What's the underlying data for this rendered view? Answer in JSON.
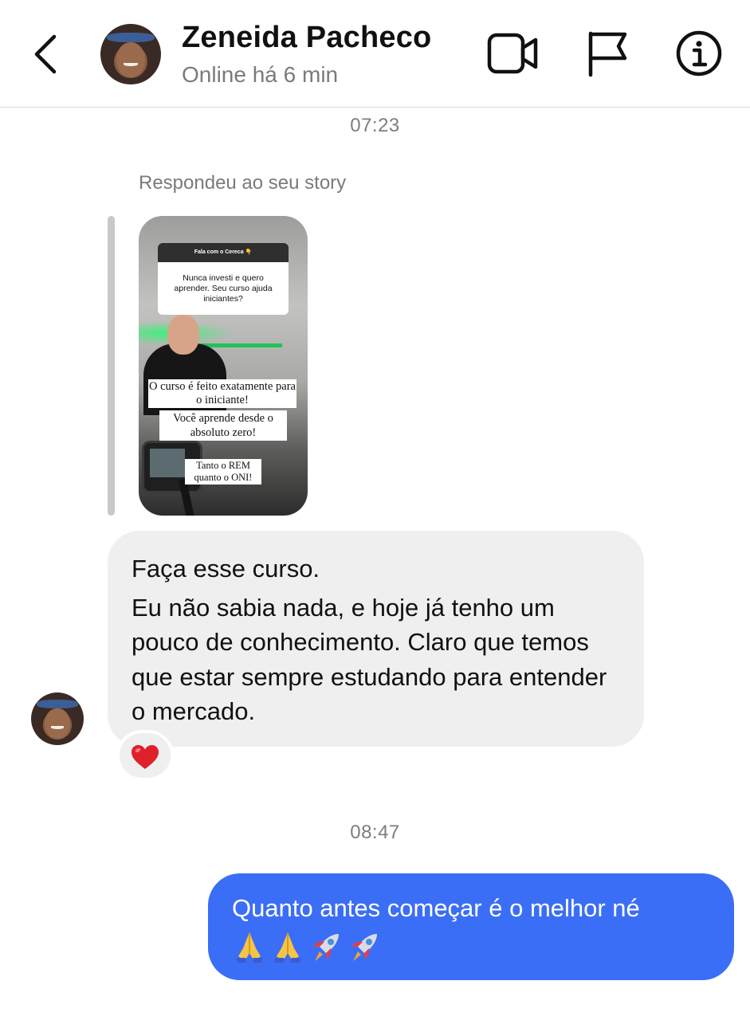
{
  "header": {
    "contact_name": "Zeneida Pacheco",
    "status": "Online há 6 min",
    "icons": [
      "chevron-left-icon",
      "video-camera-icon",
      "flag-icon",
      "info-icon"
    ]
  },
  "thread": {
    "timestamp_1": "07:23",
    "story_reply_label": "Respondeu ao seu story",
    "story": {
      "question_header": "Fala com o Cereca 👇",
      "question_text": "Nunca investi e quero aprender. Seu curso ajuda iniciantes?",
      "caption_1": "O curso é feito exatamente para o iniciante!",
      "caption_2": "Você aprende desde o absoluto zero!",
      "caption_3": "Tanto o REM quanto o ONI!"
    },
    "incoming_message": {
      "line_1": "Faça esse curso.",
      "line_2": "Eu não sabia nada, e hoje já tenho um pouco de conhecimento. Claro que temos que estar sempre estudando para entender o mercado.",
      "reaction": "❤️"
    },
    "timestamp_2": "08:47",
    "outgoing_message": {
      "text": "Quanto antes começar é o melhor né",
      "emojis": "🙏🙏🚀🚀"
    }
  },
  "colors": {
    "outgoing_bubble": "#3b6ef6",
    "incoming_bubble": "#efefef",
    "reaction_heart": "#e0202a"
  }
}
